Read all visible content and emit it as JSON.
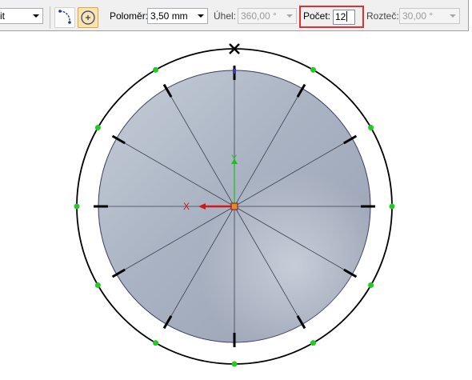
{
  "toolbar": {
    "first_combo_value": "it",
    "radius_label": "Poloměr:",
    "radius_value": "3,50 mm",
    "angle_label": "Úhel:",
    "angle_value": "360,00 °",
    "count_label": "Počet:",
    "count_value": "12",
    "spacing_label": "Rozteč:",
    "spacing_value": "30,00 °",
    "mode_buttons": [
      "arc-pattern-icon",
      "circle-center-icon"
    ]
  },
  "canvas": {
    "pattern_count": 12,
    "axis_x_label": "X",
    "axis_y_label": "Y",
    "colors": {
      "outer_circle": "#000000",
      "disk_light": "#c6ced8",
      "disk_dark": "#98a0b2",
      "point_marker": "#22cc22",
      "x_axis": "#d01a1a",
      "y_axis": "#22bb22",
      "highlight_box": "#e03030",
      "selected_button": "#fde3a7"
    }
  }
}
